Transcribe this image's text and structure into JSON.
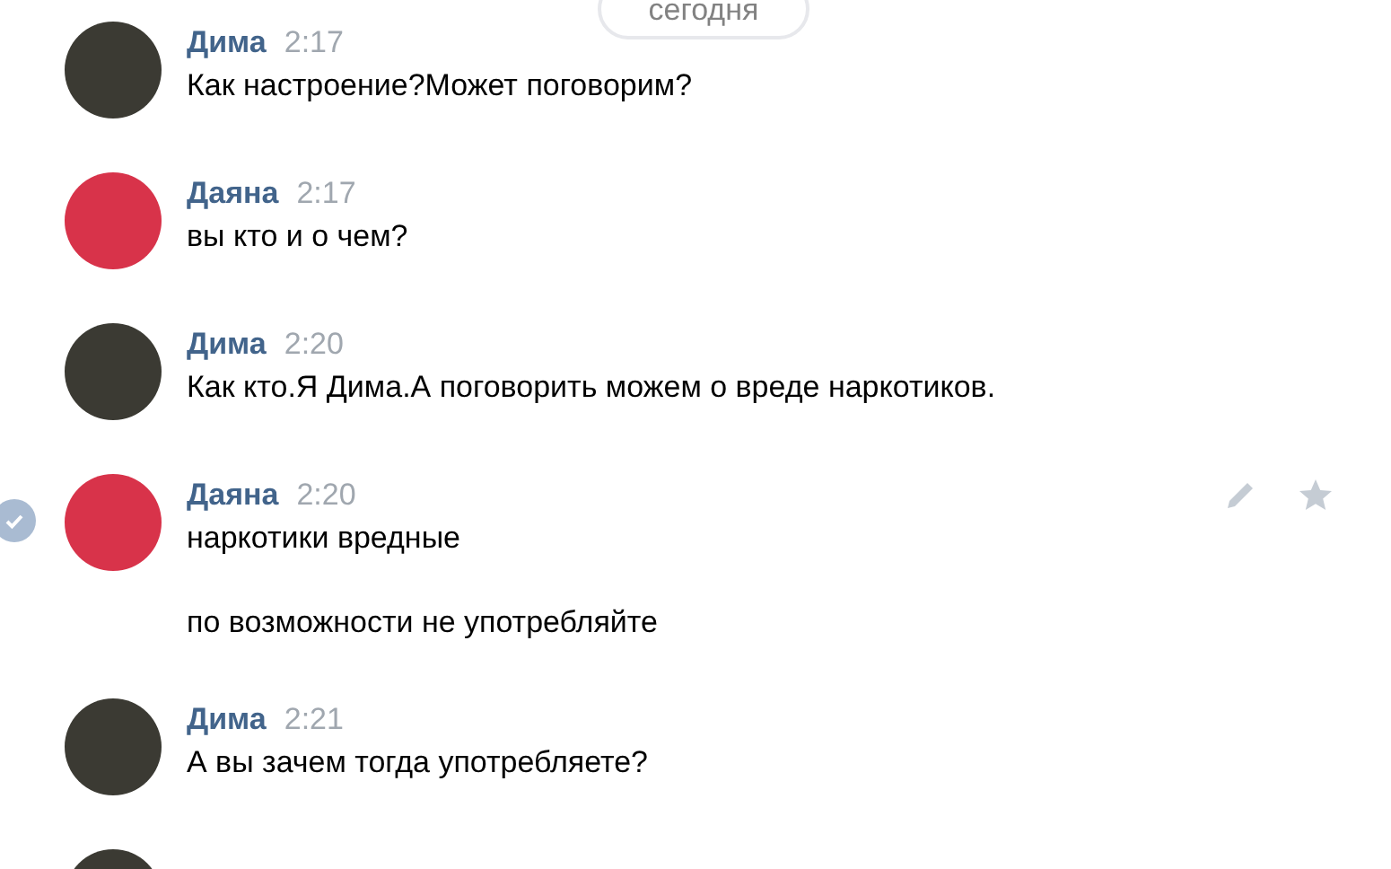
{
  "date_divider": "сегодня",
  "messages": [
    {
      "author": "Дима",
      "time": "2:17",
      "avatar": {
        "color": "#3b3a33"
      },
      "selected": false,
      "paragraphs": [
        "Как настроение?Может поговорим?"
      ]
    },
    {
      "author": "Даяна",
      "time": "2:17",
      "avatar": {
        "color": "#d8334a"
      },
      "selected": false,
      "paragraphs": [
        "вы кто и о чем?"
      ]
    },
    {
      "author": "Дима",
      "time": "2:20",
      "avatar": {
        "color": "#3b3a33"
      },
      "selected": false,
      "paragraphs": [
        "Как кто.Я Дима.А поговорить можем о вреде наркотиков."
      ]
    },
    {
      "author": "Даяна",
      "time": "2:20",
      "avatar": {
        "color": "#d8334a"
      },
      "selected": true,
      "paragraphs": [
        "наркотики вредные",
        "по возможности не употребляйте"
      ]
    },
    {
      "author": "Дима",
      "time": "2:21",
      "avatar": {
        "color": "#3b3a33"
      },
      "selected": false,
      "paragraphs": [
        "А вы зачем тогда употребляете?"
      ]
    }
  ],
  "trailing_avatar": {
    "color": "#3b3a33"
  }
}
